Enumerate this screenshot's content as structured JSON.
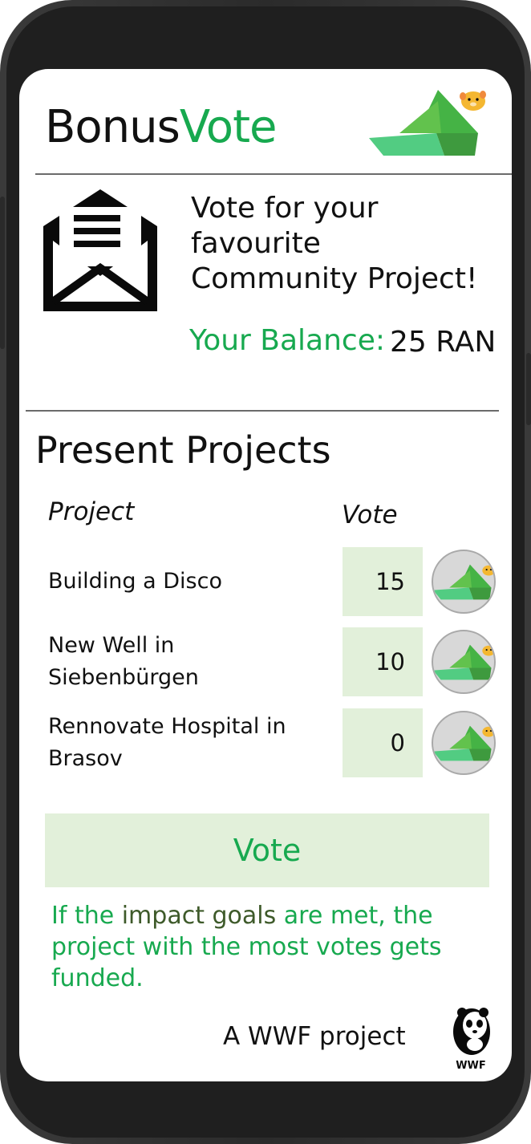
{
  "app": {
    "title_part1": "Bonus",
    "title_part2": "Vote"
  },
  "intro": {
    "message": "Vote for your favourite Community Project!",
    "balance_label": "Your Balance:",
    "balance_value": "25 RAN"
  },
  "projects": {
    "section_title": "Present Projects",
    "col_project": "Project",
    "col_vote": "Vote",
    "items": [
      {
        "name": "Building a Disco",
        "votes": "15"
      },
      {
        "name": "New Well in Siebenbürgen",
        "votes": "10"
      },
      {
        "name": "Rennovate Hospital in Brasov",
        "votes": "0"
      }
    ]
  },
  "vote_button_label": "Vote",
  "note": {
    "part1": "If the ",
    "part2": "impact goals",
    "part3": " are met, the project with the most votes gets funded."
  },
  "footer": {
    "text": "A WWF project",
    "logo_text": "WWF"
  },
  "colors": {
    "accent_green": "#17a94f",
    "light_green_bg": "#e2f0da",
    "dark_olive": "#3e5a2a"
  },
  "icons": {
    "envelope": "open-envelope-icon",
    "logo": "paper-boat-with-hamster-icon",
    "wwf": "panda-icon"
  }
}
